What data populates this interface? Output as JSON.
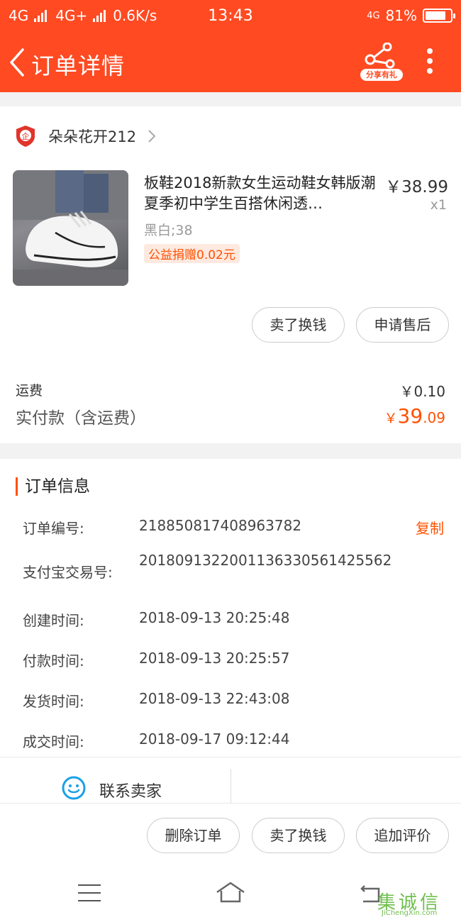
{
  "status_bar": {
    "network1": "4G",
    "network2": "4G+",
    "speed": "0.6K/s",
    "time": "13:43",
    "network3": "4G",
    "battery": "81%",
    "battery_level": 0.81
  },
  "header": {
    "title": "订单详情",
    "share_label": "分享有礼"
  },
  "shop": {
    "badge": "企",
    "name": "朵朵花开212"
  },
  "product": {
    "title": "板鞋2018新款女生运动鞋女韩版潮夏季初中学生百搭休闲透…",
    "price": "￥38.99",
    "quantity": "x1",
    "sku": "黑白;38",
    "charity": "公益捐赠0.02元"
  },
  "product_actions": {
    "sell": "卖了换钱",
    "after_sale": "申请售后"
  },
  "summary": {
    "shipping_label": "运费",
    "shipping_value": "￥0.10",
    "paid_label": "实付款（含运费）",
    "paid_currency": "￥",
    "paid_integer": "39",
    "paid_decimal": ".09"
  },
  "order_info": {
    "title": "订单信息",
    "copy_label": "复制",
    "rows": [
      {
        "key": "订单编号:",
        "value": "218850817408963782"
      },
      {
        "key": "支付宝交易号:",
        "value": "2018091322001136330561425562"
      },
      {
        "key": "创建时间:",
        "value": "2018-09-13 20:25:48"
      },
      {
        "key": "付款时间:",
        "value": "2018-09-13 20:25:57"
      },
      {
        "key": "发货时间:",
        "value": "2018-09-13 22:43:08"
      },
      {
        "key": "成交时间:",
        "value": "2018-09-17 09:12:44"
      }
    ]
  },
  "contact": {
    "label": "联系卖家"
  },
  "bottom_actions": {
    "delete": "删除订单",
    "sell": "卖了换钱",
    "review": "追加评价"
  },
  "watermark": {
    "text": "集诚信",
    "sub": "JiChengXin.com"
  },
  "colors": {
    "brand": "#ff4a22",
    "accent": "#ff5000"
  },
  "icons": [
    "back-arrow-icon",
    "share-icon",
    "more-icon",
    "shop-badge-icon",
    "chevron-right-icon",
    "chat-smile-icon",
    "menu-icon",
    "home-icon",
    "return-icon"
  ]
}
